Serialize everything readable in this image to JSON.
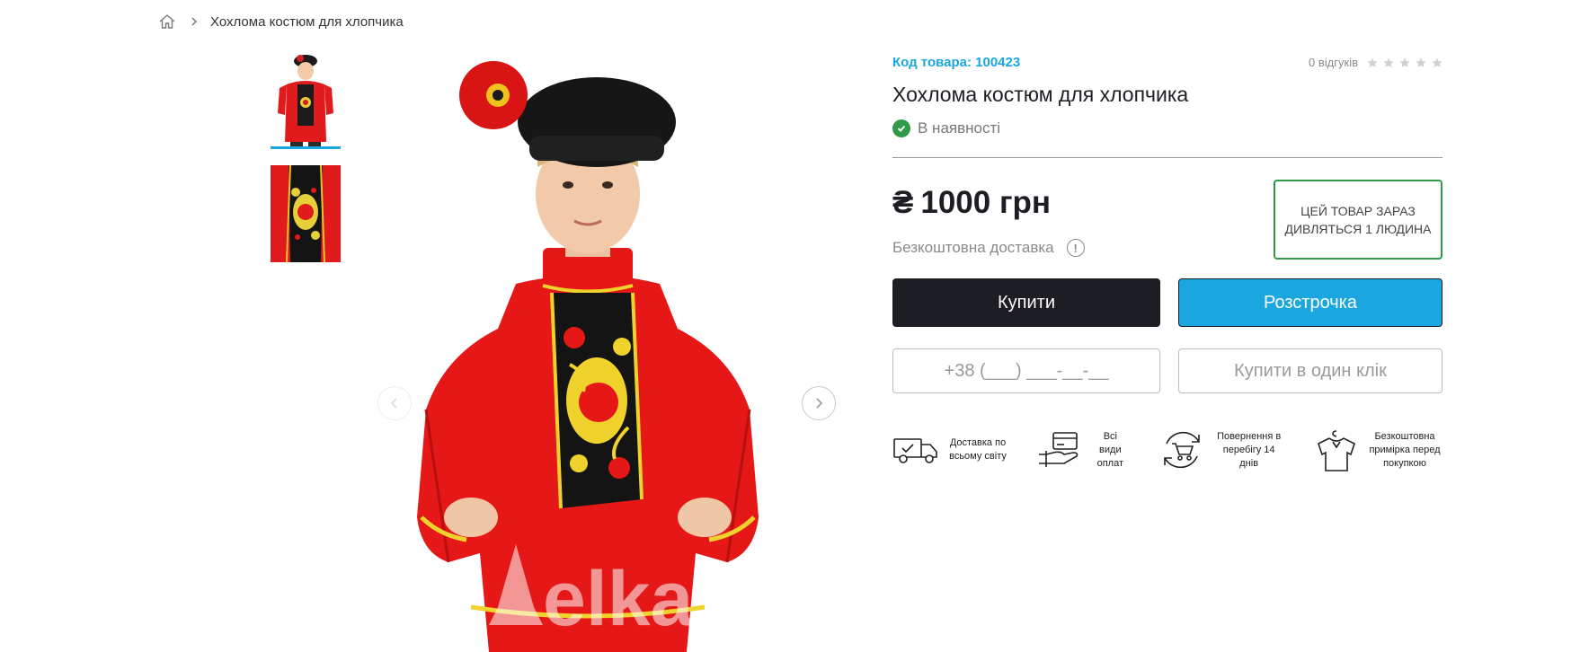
{
  "breadcrumb": {
    "home_icon": "home-icon",
    "current": "Хохлома костюм для хлопчика"
  },
  "gallery": {
    "watermark": "elka",
    "thumbnails": [
      {
        "label": "thumbnail-1",
        "active": true
      },
      {
        "label": "thumbnail-2",
        "active": false
      }
    ]
  },
  "product": {
    "code_label": "Код товара: 100423",
    "reviews_count": "0 відгуків",
    "rating": 0,
    "rating_max": 5,
    "title": "Хохлома костюм для хлопчика",
    "stock": "В наявності",
    "price": "1000 грн",
    "currency_symbol": "₴",
    "delivery": "Безкоштовна доставка",
    "info_icon": "!",
    "watching": "Цей товар зараз дивляться 1 людина"
  },
  "actions": {
    "buy": "Купити",
    "credit": "Розстрочка",
    "phone_placeholder": "+38 (___) ___-__-__",
    "one_click": "Купити в один клік"
  },
  "features": [
    {
      "icon": "delivery-truck-icon",
      "label": "Доставка по всьому світу"
    },
    {
      "icon": "payment-card-icon",
      "label": "Всі види оплат"
    },
    {
      "icon": "return-cart-icon",
      "label": "Повернення в перебігу 14 днів"
    },
    {
      "icon": "shirt-icon",
      "label": "Безкоштовна примірка перед покупкою"
    }
  ],
  "colors": {
    "accent": "#1aa7e0",
    "dark": "#1d1d24",
    "success": "#2f9b48"
  }
}
